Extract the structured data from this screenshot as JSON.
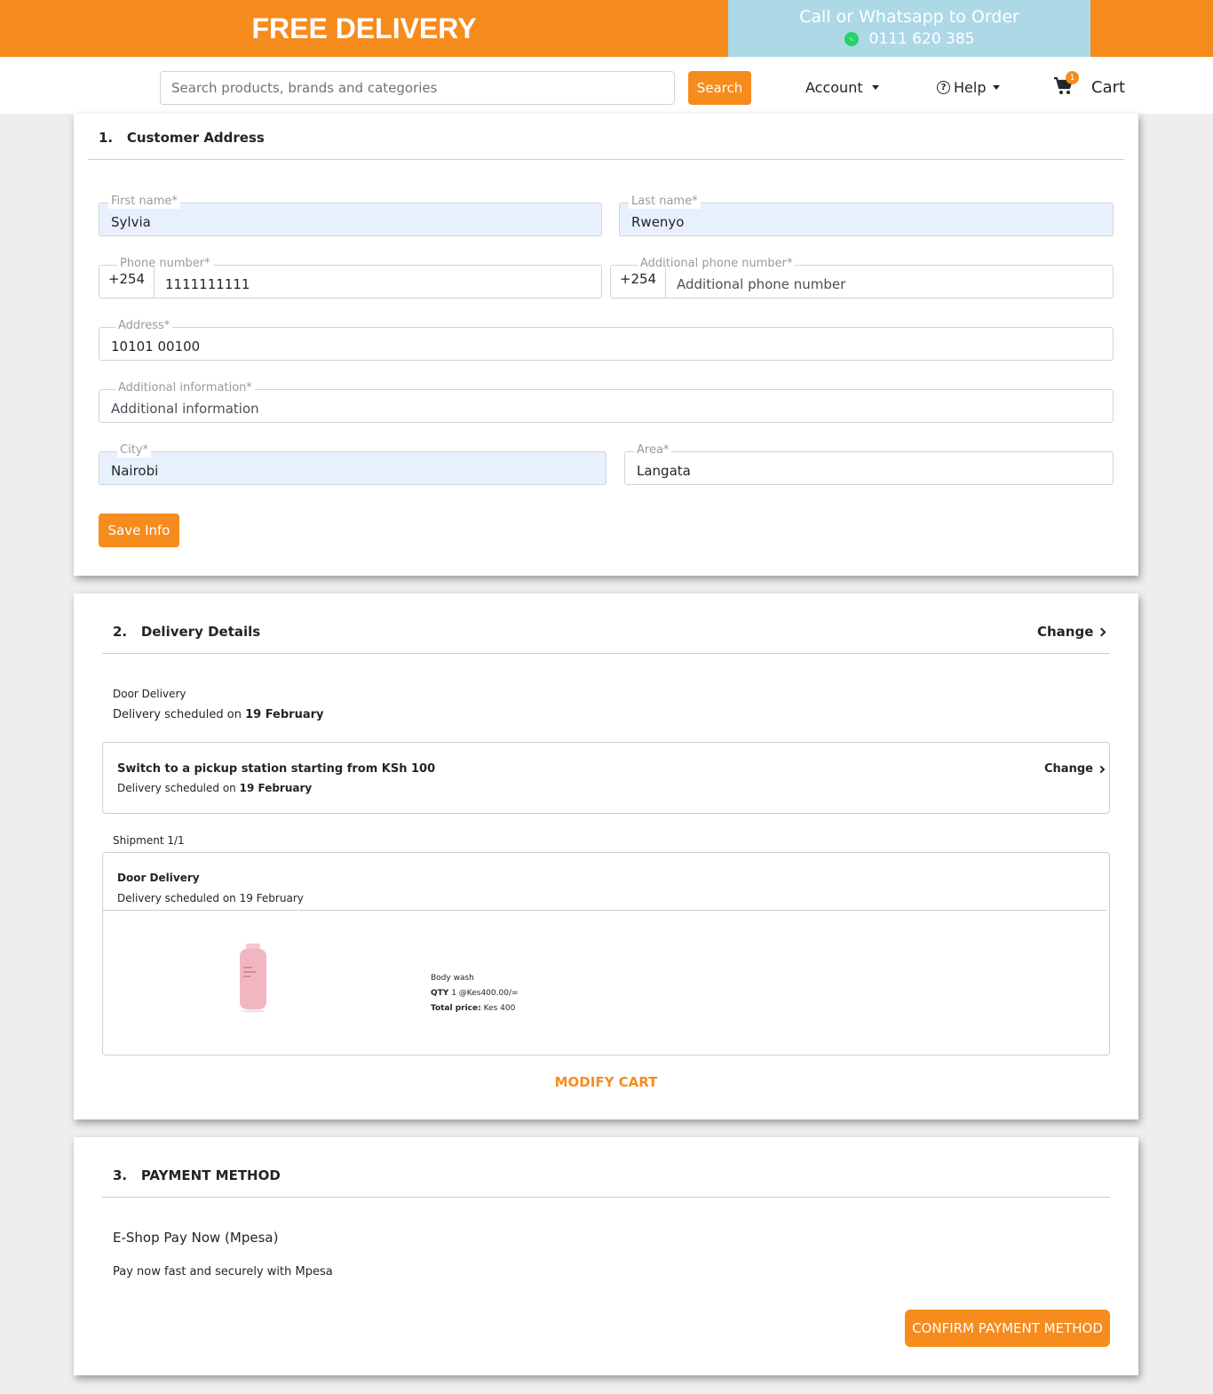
{
  "banner": {
    "free_delivery": "FREE DELIVERY",
    "call_line": "Call or Whatsapp to Order",
    "phone": "0111 620 385"
  },
  "nav": {
    "search_placeholder": "Search products, brands and categories",
    "search_button": "Search",
    "account": "Account",
    "help": "Help",
    "cart": "Cart",
    "cart_count": "1"
  },
  "customer_address": {
    "step": "1.",
    "title": "Customer Address",
    "first_name": {
      "label": "First name*",
      "value": "Sylvia"
    },
    "last_name": {
      "label": "Last name*",
      "value": "Rwenyo"
    },
    "phone": {
      "label": "Phone number*",
      "prefix": "+254",
      "value": "1111111111"
    },
    "additional_phone": {
      "label": "Additional phone number*",
      "prefix": "+254",
      "placeholder": "Additional phone number"
    },
    "address": {
      "label": "Address*",
      "value": "10101 00100"
    },
    "additional_info": {
      "label": "Additional information*",
      "placeholder": "Additional information"
    },
    "city": {
      "label": "City*",
      "value": "Nairobi"
    },
    "area": {
      "label": "Area*",
      "value": "Langata"
    },
    "save_button": "Save Info"
  },
  "delivery_details": {
    "step": "2.",
    "title": "Delivery Details",
    "change": "Change",
    "method": "Door Delivery",
    "scheduled_prefix": "Delivery scheduled on",
    "date": "19 February",
    "pickup_title": "Switch to a pickup station starting from KSh 100",
    "pickup_change": "Change",
    "shipment_label": "Shipment 1/1",
    "shipment_method": "Door Delivery",
    "shipment_scheduled": "Delivery scheduled on 19 February",
    "product": {
      "name": "Body wash",
      "qty_label": "QTY",
      "qty_value": "1 @Kes400.00/=",
      "total_label": "Total price:",
      "total_value": "Kes 400"
    },
    "modify_cart": "MODIFY CART"
  },
  "payment": {
    "step": "3.",
    "title": "PAYMENT METHOD",
    "option": "E-Shop Pay Now (Mpesa)",
    "description": "Pay now fast and securely with Mpesa",
    "confirm_button": "CONFIRM PAYMENT METHOD"
  },
  "colors": {
    "accent": "#f68b1e",
    "call_bg": "#add8e6",
    "autofill": "#e8f0fe"
  },
  "icons": [
    "whatsapp-icon",
    "caret-down-icon",
    "help-circle-icon",
    "cart-icon",
    "chevron-right-icon"
  ]
}
